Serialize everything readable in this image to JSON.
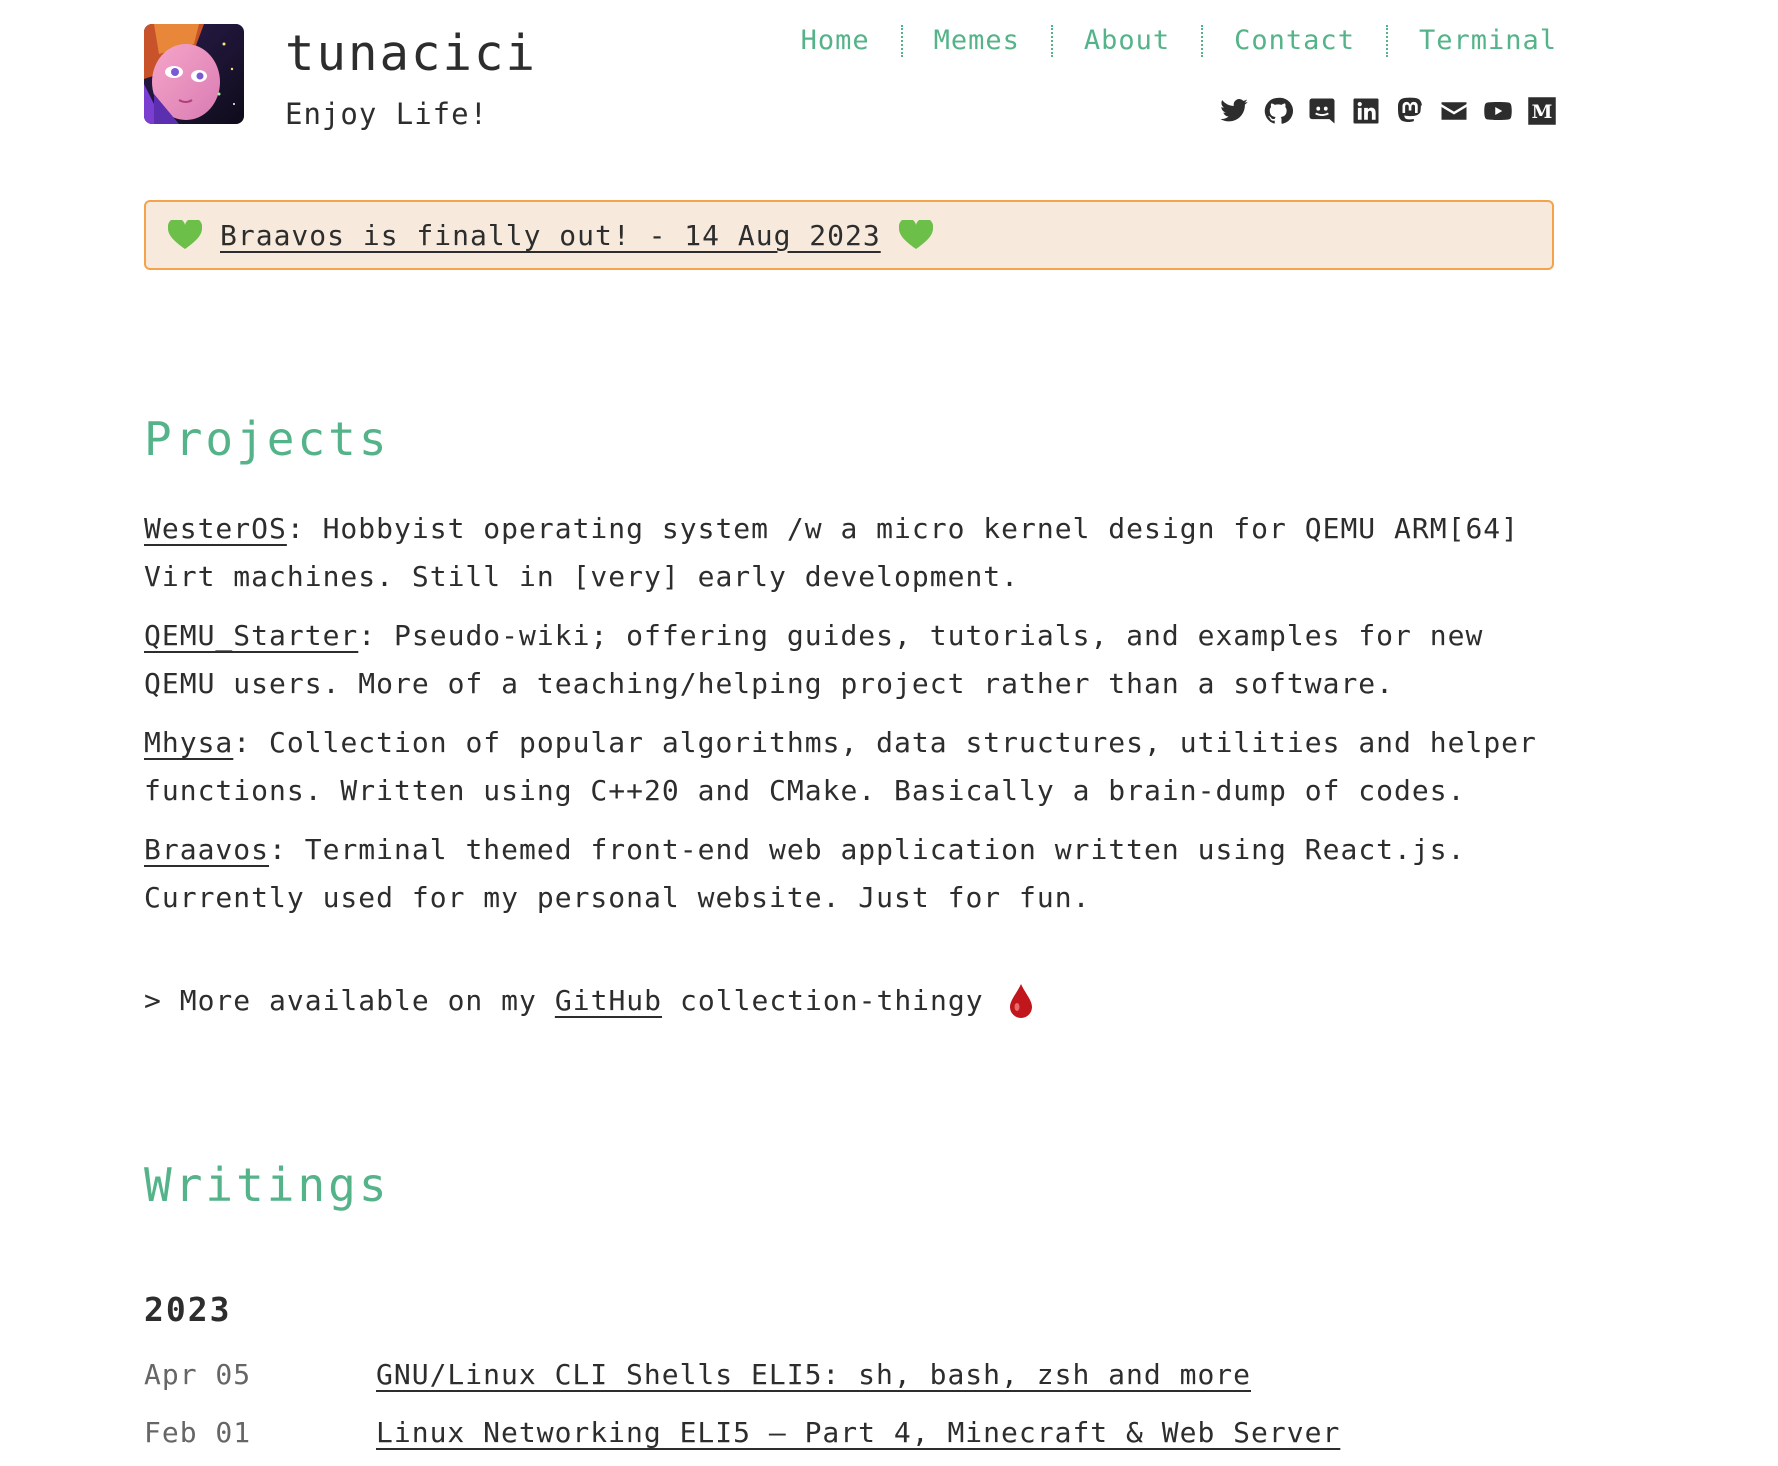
{
  "header": {
    "site_title": "tunacici",
    "tagline": "Enjoy Life!"
  },
  "nav": {
    "items": [
      "Home",
      "Memes",
      "About",
      "Contact",
      "Terminal"
    ]
  },
  "socials": [
    "twitter-icon",
    "github-icon",
    "discord-icon",
    "linkedin-icon",
    "mastodon-icon",
    "email-icon",
    "youtube-icon",
    "medium-icon"
  ],
  "banner": {
    "text": "Braavos is finally out! - 14 Aug 2023",
    "emoji": "green-heart"
  },
  "projects": {
    "title": "Projects",
    "items": [
      {
        "name": "WesterOS",
        "desc": ": Hobbyist operating system /w a micro kernel design for QEMU ARM[64] Virt machines. Still in [very] early development."
      },
      {
        "name": "QEMU_Starter",
        "desc": ": Pseudo-wiki; offering guides, tutorials, and examples for new QEMU users. More of a teaching/helping project rather than a software."
      },
      {
        "name": "Mhysa",
        "desc": ": Collection of popular algorithms, data structures, utilities and helper functions. Written using C++20 and CMake. Basically a brain-dump of codes."
      },
      {
        "name": "Braavos",
        "desc": ": Terminal themed front-end web application written using React.js. Currently used for my personal website. Just for fun."
      }
    ],
    "more_prefix": "> More available on my",
    "more_link": "GitHub",
    "more_suffix": "collection-thingy"
  },
  "writings": {
    "title": "Writings",
    "year": "2023",
    "posts": [
      {
        "date": "Apr 05",
        "title": "GNU/Linux CLI Shells ELI5: sh, bash, zsh and more"
      },
      {
        "date": "Feb 01",
        "title": "Linux Networking ELI5 — Part 4, Minecraft & Web Server"
      }
    ]
  },
  "colors": {
    "accent": "#55b389",
    "banner_border": "#f5a34b",
    "banner_bg": "#f7eadd",
    "text": "#2d2d2d"
  }
}
